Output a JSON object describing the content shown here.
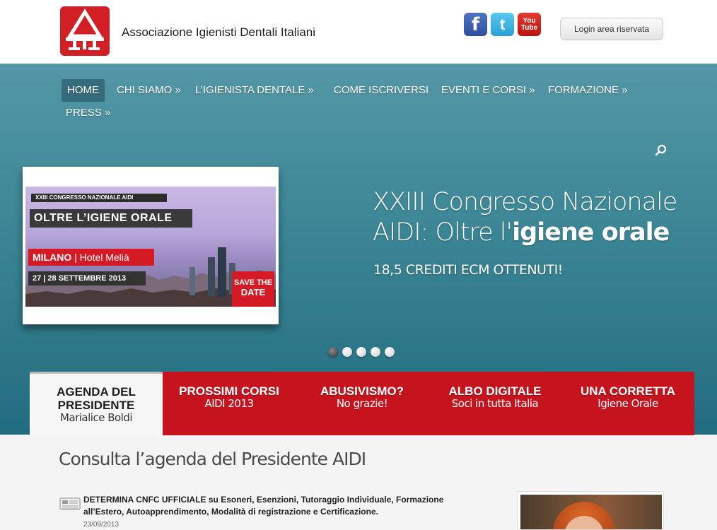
{
  "header": {
    "site_name": "Associazione Igienisti Dentali Italiani",
    "login_label": "Login area riservata",
    "social": {
      "facebook": "f",
      "twitter": "t",
      "youtube_top": "You",
      "youtube_bottom": "Tube"
    }
  },
  "nav": {
    "items": [
      {
        "label": "HOME"
      },
      {
        "label": "CHI SIAMO »"
      },
      {
        "label": "L’IGIENISTA DENTALE »"
      },
      {
        "label": "COME ISCRIVERSI"
      },
      {
        "label": "EVENTI E CORSI »"
      },
      {
        "label": "FORMAZIONE »"
      },
      {
        "label": "PRESS »"
      }
    ]
  },
  "slider": {
    "banner": {
      "top_label": "XXIII CONGRESSO NAZIONALE AIDI",
      "title": "OLTRE L’IGIENE ORALE",
      "city": "MILANO",
      "venue": "| Hotel Melià",
      "date": "27 | 28 SETTEMBRE 2013",
      "save_line1": "SAVE THE",
      "save_line2": "DATE"
    },
    "title_line1": "XXIII Congresso Nazionale",
    "title_line2_prefix": "AIDI: Oltre l'",
    "title_line2_emphasis": "igiene orale",
    "subtitle": "18,5 CREDITI ECM OTTENUTI!",
    "total_slides": 5,
    "active_slide": 1
  },
  "tabs": [
    {
      "title": "AGENDA DEL PRESIDENTE",
      "title_line1": "AGENDA DEL",
      "title_line2": "PRESIDENTE",
      "subtitle": "Marialice Boldi"
    },
    {
      "title": "PROSSIMI CORSI",
      "subtitle": "AIDI 2013"
    },
    {
      "title": "ABUSIVISMO?",
      "subtitle": "No grazie!"
    },
    {
      "title": "ALBO DIGITALE",
      "subtitle": "Soci in tutta Italia"
    },
    {
      "title": "UNA CORRETTA",
      "subtitle": "Igiene Orale"
    }
  ],
  "content": {
    "heading": "Consulta l’agenda del Presidente AIDI",
    "news": [
      {
        "text": "DETERMINA CNFC UFFICIALE su Esoneri, Esenzioni, Tutoraggio Individuale, Formazione all’Estero, Autoapprendimento, Modalità di registrazione e Certificazione.",
        "date": "23/09/2013"
      }
    ]
  },
  "colors": {
    "brand_red": "#c5141e",
    "hero_teal": "#3b8696",
    "logo_red": "#d21f26"
  }
}
